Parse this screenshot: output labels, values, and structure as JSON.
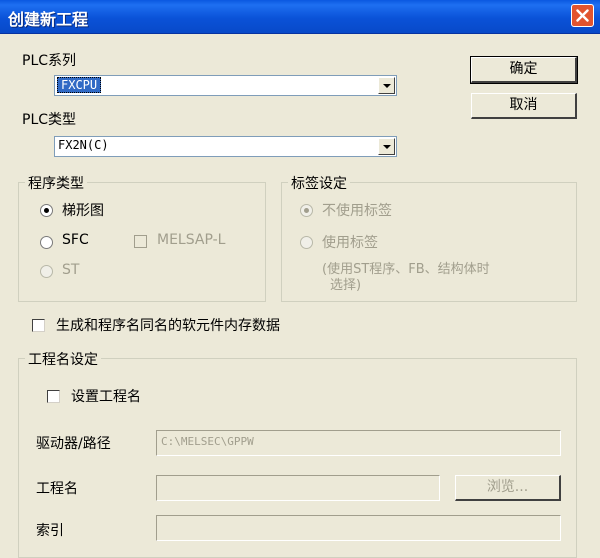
{
  "window": {
    "title": "创建新工程"
  },
  "buttons": {
    "ok": "确定",
    "cancel": "取消",
    "browse": "浏览..."
  },
  "plc_series": {
    "label": "PLC系列",
    "value": "FXCPU"
  },
  "plc_type": {
    "label": "PLC类型",
    "value": "FX2N(C)"
  },
  "program_type": {
    "title": "程序类型",
    "ladder": "梯形图",
    "sfc": "SFC",
    "melsap": "MELSAP-L",
    "st": "ST"
  },
  "label_settings": {
    "title": "标签设定",
    "no_label": "不使用标签",
    "use_label": "使用标签",
    "note_line1": "(使用ST程序、FB、结构体时",
    "note_line2": "选择)"
  },
  "generate_memory": {
    "label": "生成和程序名同名的软元件内存数据"
  },
  "project_name_settings": {
    "title": "工程名设定",
    "set_name": "设置工程名",
    "drive_path_label": "驱动器/路径",
    "drive_path_value": "C:\\MELSEC\\GPPW",
    "project_name_label": "工程名",
    "index_label": "索引"
  }
}
